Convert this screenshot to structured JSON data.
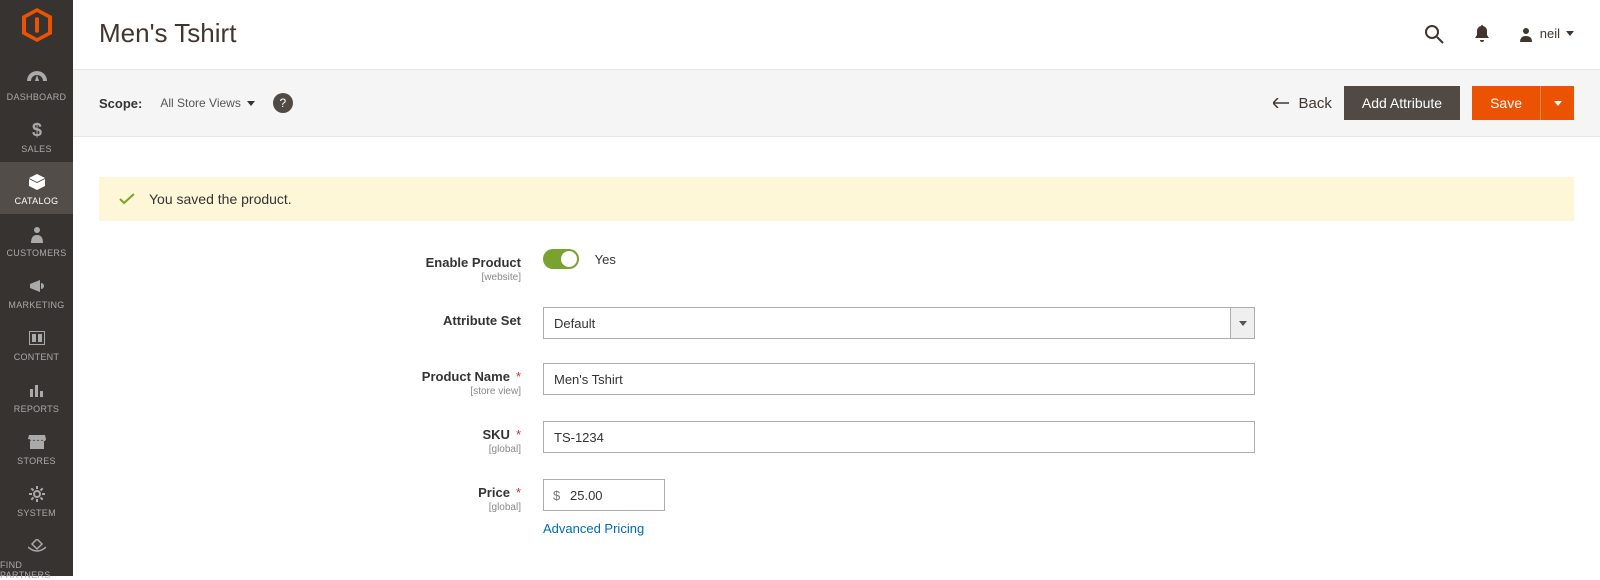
{
  "sidebar": {
    "items": [
      {
        "label": "DASHBOARD"
      },
      {
        "label": "SALES"
      },
      {
        "label": "CATALOG"
      },
      {
        "label": "CUSTOMERS"
      },
      {
        "label": "MARKETING"
      },
      {
        "label": "CONTENT"
      },
      {
        "label": "REPORTS"
      },
      {
        "label": "STORES"
      },
      {
        "label": "SYSTEM"
      },
      {
        "label": "FIND PARTNERS"
      }
    ]
  },
  "header": {
    "title": "Men's Tshirt",
    "user_name": "neil"
  },
  "toolbar": {
    "scope_label": "Scope:",
    "scope_value": "All Store Views",
    "back_label": "Back",
    "add_attribute_label": "Add Attribute",
    "save_label": "Save"
  },
  "message": {
    "success": "You saved the product."
  },
  "form": {
    "enable_product": {
      "label": "Enable Product",
      "sublabel": "[website]",
      "value_text": "Yes"
    },
    "attribute_set": {
      "label": "Attribute Set",
      "value": "Default"
    },
    "product_name": {
      "label": "Product Name",
      "sublabel": "[store view]",
      "value": "Men's Tshirt"
    },
    "sku": {
      "label": "SKU",
      "sublabel": "[global]",
      "value": "TS-1234"
    },
    "price": {
      "label": "Price",
      "sublabel": "[global]",
      "currency": "$",
      "value": "25.00",
      "advanced_link": "Advanced Pricing"
    }
  }
}
